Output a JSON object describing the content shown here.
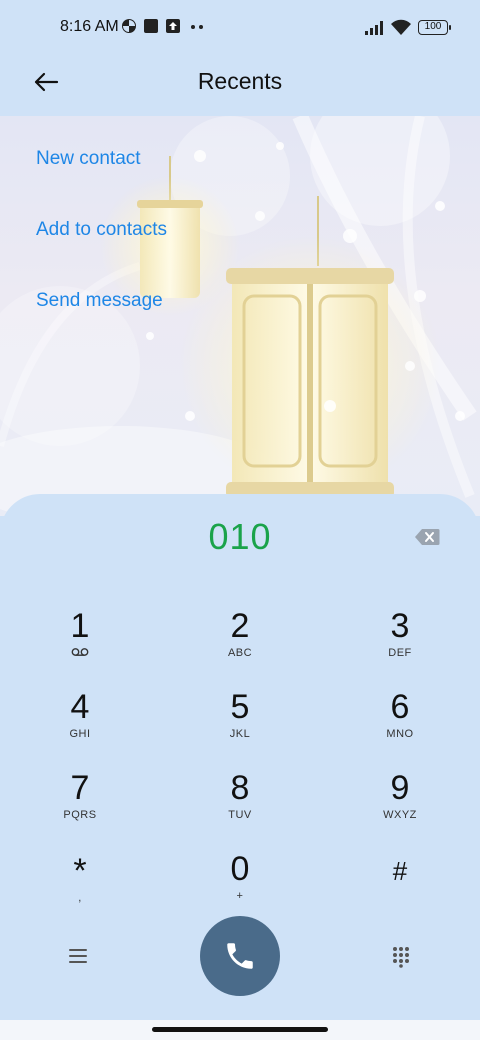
{
  "status_bar": {
    "time": "8:16 AM",
    "battery": "100",
    "icons": [
      "pinwheel-icon",
      "square-icon",
      "upload-icon",
      "more-dots-icon",
      "signal-icon",
      "wifi-icon",
      "battery-icon"
    ]
  },
  "header": {
    "title": "Recents",
    "back_icon": "arrow-left-icon"
  },
  "actions": {
    "new_contact": "New contact",
    "add_to_contacts": "Add to contacts",
    "send_message": "Send message"
  },
  "dialpad": {
    "number": "010",
    "backspace_icon": "backspace-icon",
    "keys": [
      {
        "digit": "1",
        "letters": ""
      },
      {
        "digit": "2",
        "letters": "ABC"
      },
      {
        "digit": "3",
        "letters": "DEF"
      },
      {
        "digit": "4",
        "letters": "GHI"
      },
      {
        "digit": "5",
        "letters": "JKL"
      },
      {
        "digit": "6",
        "letters": "MNO"
      },
      {
        "digit": "7",
        "letters": "PQRS"
      },
      {
        "digit": "8",
        "letters": "TUV"
      },
      {
        "digit": "9",
        "letters": "WXYZ"
      },
      {
        "digit": "*",
        "letters": ","
      },
      {
        "digit": "0",
        "letters": "+"
      },
      {
        "digit": "#",
        "letters": ""
      }
    ],
    "menu_icon": "menu-icon",
    "call_icon": "phone-icon",
    "keypad_icon": "keypad-icon"
  },
  "colors": {
    "background": "#cfe2f7",
    "link": "#1e86e6",
    "number": "#1aa34a",
    "call_button": "#4a6b8a"
  }
}
